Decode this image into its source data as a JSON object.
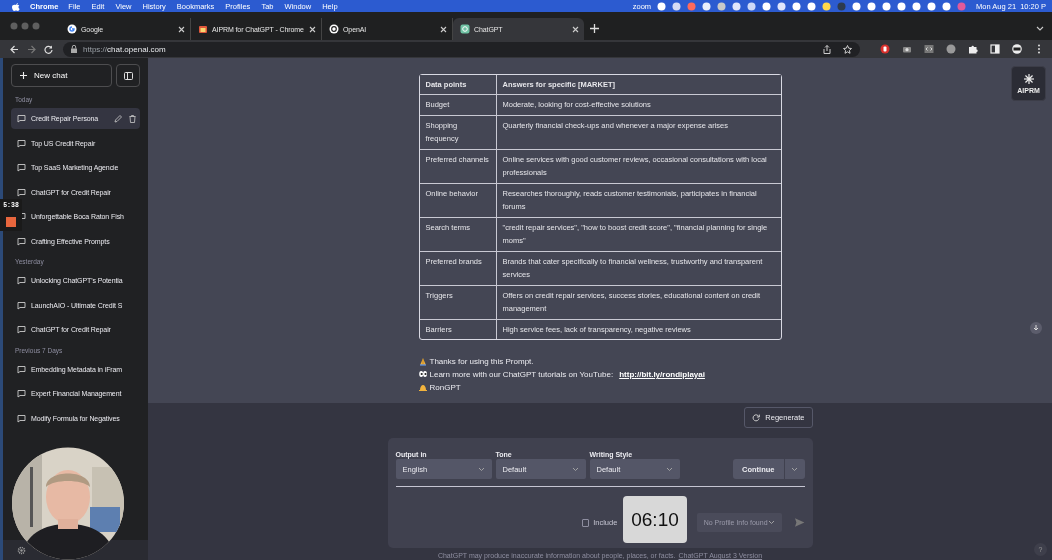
{
  "menu_bar": {
    "app": "Chrome",
    "menus": [
      "File",
      "Edit",
      "View",
      "History",
      "Bookmarks",
      "Profiles",
      "Tab",
      "Window",
      "Help"
    ],
    "status_text": "zoom",
    "date": "Mon Aug 21",
    "time": "10:20 P"
  },
  "tabs": [
    {
      "title": "Google",
      "selected": false
    },
    {
      "title": "AIPRM for ChatGPT - Chrome",
      "selected": false
    },
    {
      "title": "OpenAI",
      "selected": false
    },
    {
      "title": "ChatGPT",
      "selected": true
    }
  ],
  "address_bar": {
    "scheme": "https://",
    "host": "chat.openai.com"
  },
  "sidebar": {
    "new_chat": "New chat",
    "sections": [
      {
        "heading": "Today",
        "items": [
          {
            "title": "Credit Repair Persona",
            "selected": true
          },
          {
            "title": "Top US Credit Repair",
            "selected": false
          },
          {
            "title": "Top SaaS Marketing Agencie",
            "selected": false
          },
          {
            "title": "ChatGPT for Credit Repair",
            "selected": false
          },
          {
            "title": "Unforgettable Boca Raton Fish",
            "selected": false
          },
          {
            "title": "Crafting Effective Prompts",
            "selected": false
          }
        ]
      },
      {
        "heading": "Yesterday",
        "items": [
          {
            "title": "Unlocking ChatGPT's Potentia",
            "selected": false
          },
          {
            "title": "LaunchAIO - Ultimate Credit S",
            "selected": false
          },
          {
            "title": "ChatGPT for Credit Repair",
            "selected": false
          }
        ]
      },
      {
        "heading": "Previous 7 Days",
        "items": [
          {
            "title": "Embedding Metadata in iFram",
            "selected": false
          },
          {
            "title": "Expert Financial Management",
            "selected": false
          },
          {
            "title": "Modify Formula for Negatives",
            "selected": false
          }
        ]
      }
    ]
  },
  "recorder_overlay": {
    "time": "5:38"
  },
  "table": {
    "columns": [
      "Data points",
      "Answers for specific [MARKET]"
    ],
    "rows": [
      [
        "Budget",
        "Moderate, looking for cost-effective solutions"
      ],
      [
        "Shopping frequency",
        "Quarterly financial check-ups and whenever a major expense arises"
      ],
      [
        "Preferred channels",
        "Online services with good customer reviews, occasional consultations with local professionals"
      ],
      [
        "Online behavior",
        "Researches thoroughly, reads customer testimonials, participates in financial forums"
      ],
      [
        "Search terms",
        "\"credit repair services\", \"how to boost credit score\", \"financial planning for single moms\""
      ],
      [
        "Preferred brands",
        "Brands that cater specifically to financial wellness, trustworthy and transparent services"
      ],
      [
        "Triggers",
        "Offers on credit repair services, success stories, educational content on credit management"
      ],
      [
        "Barriers",
        "High service fees, lack of transparency, negative reviews"
      ]
    ]
  },
  "messages": [
    {
      "kind": "hands",
      "text": "Thanks for using this Prompt."
    },
    {
      "kind": "eyes",
      "text": "Learn more with our ChatGPT tutorials on YouTube:",
      "link": "http://bit.ly/rondiplayai"
    },
    {
      "kind": "bow",
      "text": "RonGPT"
    }
  ],
  "aiprm_button": "AIPRM",
  "regenerate": "Regenerate",
  "prompt_panel": {
    "fields": [
      {
        "label": "Output in",
        "value": "English"
      },
      {
        "label": "Tone",
        "value": "Default"
      },
      {
        "label": "Writing Style",
        "value": "Default"
      }
    ],
    "continue": "Continue",
    "include_label": "Include",
    "include_checked": false,
    "profile_select": "No Profile Info found"
  },
  "timer": "06:10",
  "disclaimer": {
    "text": "ChatGPT may produce inaccurate information about people, places, or facts.",
    "link": "ChatGPT August 3 Version"
  },
  "help": "?"
}
